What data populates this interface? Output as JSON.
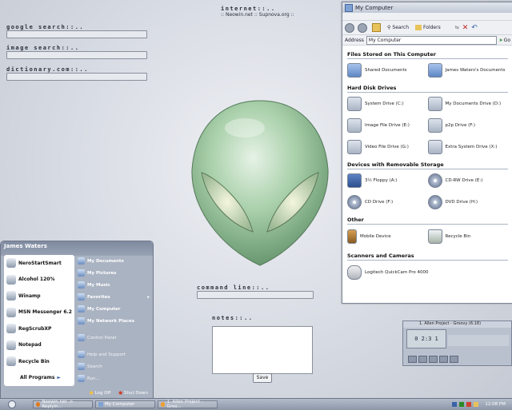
{
  "desktop": {
    "internet_title": "internet::..",
    "internet_links": ":: Neowin.net :: Supnova.org ::",
    "search_fields": [
      {
        "label": "google search::.."
      },
      {
        "label": "image search::.."
      },
      {
        "label": "dictionary.com::.."
      }
    ],
    "command_line_label": "command line::..",
    "notes_label": "notes::..",
    "save_label": "Save"
  },
  "explorer": {
    "title": "My Computer",
    "toolbar": {
      "search": "Search",
      "folders": "Folders"
    },
    "address_label": "Address",
    "address_value": "My Computer",
    "go_label": "Go",
    "sections": [
      {
        "title": "Files Stored on This Computer",
        "items": [
          {
            "label": "Shared Documents",
            "icon": "folder-icon"
          },
          {
            "label": "James Waters's Documents",
            "icon": "folder-icon"
          }
        ]
      },
      {
        "title": "Hard Disk Drives",
        "items": [
          {
            "label": "System Drive (C:)",
            "icon": "hard-drive-icon"
          },
          {
            "label": "My Documents Drive (D:)",
            "icon": "hard-drive-icon"
          },
          {
            "label": "Image File Drive (E:)",
            "icon": "hard-drive-icon"
          },
          {
            "label": "p2p Drive (F:)",
            "icon": "hard-drive-icon"
          },
          {
            "label": "Video File Drive (G:)",
            "icon": "hard-drive-icon"
          },
          {
            "label": "Extra System Drive (X:)",
            "icon": "hard-drive-icon"
          }
        ]
      },
      {
        "title": "Devices with Removable Storage",
        "items": [
          {
            "label": "3½ Floppy (A:)",
            "icon": "floppy-icon"
          },
          {
            "label": "CD-RW Drive (E:)",
            "icon": "cd-drive-icon"
          },
          {
            "label": "CD Drive (F:)",
            "icon": "cd-drive-icon"
          },
          {
            "label": "DVD Drive (H:)",
            "icon": "cd-drive-icon"
          }
        ]
      },
      {
        "title": "Other",
        "items": [
          {
            "label": "Mobile Device",
            "icon": "mobile-device-icon"
          },
          {
            "label": "Recycle Bin",
            "icon": "recycle-bin-icon"
          }
        ]
      },
      {
        "title": "Scanners and Cameras",
        "items": [
          {
            "label": "Logitech QuickCam Pro 4000",
            "icon": "webcam-icon"
          }
        ]
      }
    ]
  },
  "start_menu": {
    "user": "James Waters",
    "left_items": [
      "NeroStartSmart",
      "Alcohol 120%",
      "Winamp",
      "MSN Messenger 6.2",
      "RegScrubXP",
      "Notepad",
      "Recycle Bin"
    ],
    "all_programs": "All Programs",
    "right_items": [
      "My Documents",
      "My Pictures",
      "My Music",
      "Favorites",
      "My Computer",
      "My Network Places"
    ],
    "right_items_2": [
      "Control Panel",
      "Help and Support",
      "Search",
      "Run..."
    ],
    "log_off": "Log Off",
    "shut_down": "Shut Down"
  },
  "taskbar": {
    "tasks": [
      "Neowin.net -> Replyin...",
      "My Computer",
      "1. Allen Project - Groo..."
    ],
    "clock": "12:08 PM"
  },
  "player": {
    "title": "1. Allen Project - Groovy (6:18)",
    "time": "0 2:3 1"
  }
}
